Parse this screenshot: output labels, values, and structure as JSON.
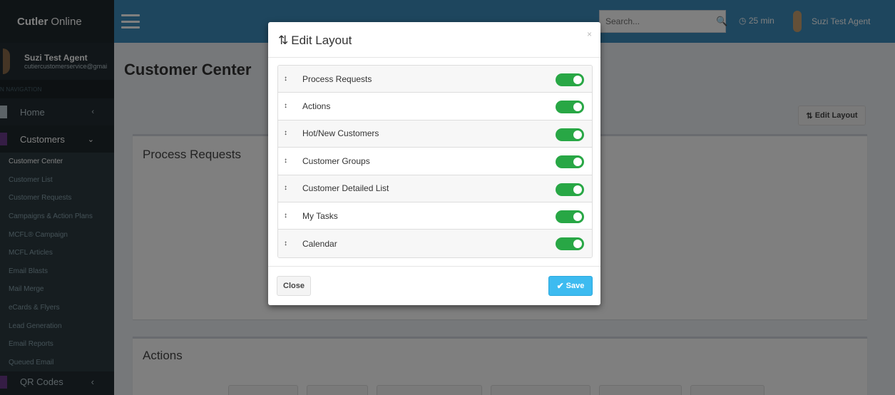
{
  "app": {
    "brand_bold": "Cutler",
    "brand_rest": "Online"
  },
  "user": {
    "name": "Suzi Test Agent",
    "email": "cutiercustomerservice@gmai"
  },
  "sidebar": {
    "header": "N NAVIGATION",
    "home": "Home",
    "customers": "Customers",
    "sub_items": [
      "Customer Center",
      "Customer List",
      "Customer Requests",
      "Campaigns & Action Plans",
      "MCFL® Campaign",
      "MCFL Articles",
      "Email Blasts",
      "Mail Merge",
      "eCards & Flyers",
      "Lead Generation",
      "Email Reports",
      "Queued Email"
    ],
    "qr": "QR Codes"
  },
  "topbar": {
    "search_placeholder": "Search...",
    "timer": "25 min",
    "agent_name": "Suzi Test Agent"
  },
  "page": {
    "title": "Customer Center",
    "edit_layout": "Edit Layout",
    "box1_title": "Process Requests",
    "box2_title": "Actions"
  },
  "modal": {
    "title": "Edit Layout",
    "close_x": "×",
    "items": [
      {
        "label": "Process Requests",
        "on": true
      },
      {
        "label": "Actions",
        "on": true
      },
      {
        "label": "Hot/New Customers",
        "on": true
      },
      {
        "label": "Customer Groups",
        "on": true
      },
      {
        "label": "Customer Detailed List",
        "on": true
      },
      {
        "label": "My Tasks",
        "on": true
      },
      {
        "label": "Calendar",
        "on": true
      }
    ],
    "close_label": "Close",
    "save_label": "Save"
  },
  "colors": {
    "toggle_on": "#28a745",
    "save": "#3dbbf0",
    "topbar": "#3c8dbc",
    "sidebar": "#222d32"
  }
}
